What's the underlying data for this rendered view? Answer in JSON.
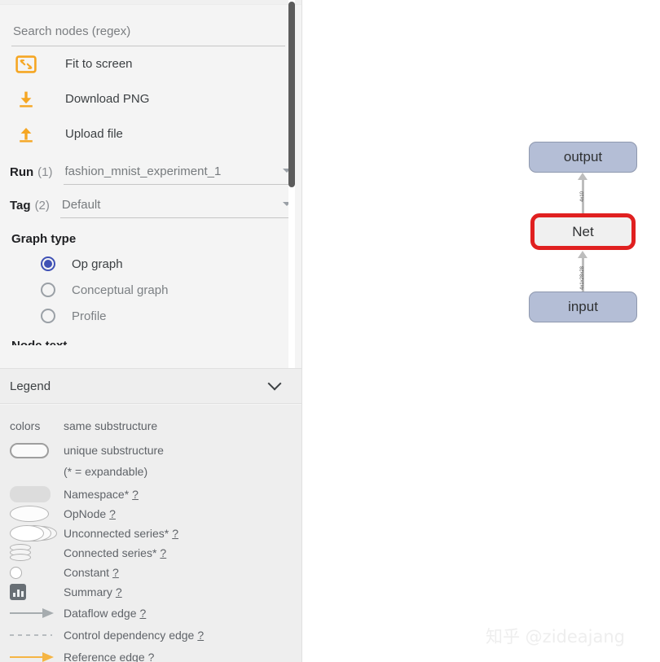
{
  "sidebar": {
    "search": {
      "placeholder": "Search nodes (regex)",
      "value": ""
    },
    "actions": [
      {
        "label": "Fit to screen",
        "icon": "fit-to-screen-icon"
      },
      {
        "label": "Download PNG",
        "icon": "download-icon"
      },
      {
        "label": "Upload file",
        "icon": "upload-icon"
      }
    ],
    "selectors": [
      {
        "key": "Run",
        "count": "(1)",
        "value": "fashion_mnist_experiment_1"
      },
      {
        "key": "Tag",
        "count": "(2)",
        "value": "Default"
      }
    ],
    "graph_type": {
      "title": "Graph type",
      "options": [
        {
          "label": "Op graph",
          "selected": true,
          "enabled": true
        },
        {
          "label": "Conceptual graph",
          "selected": false,
          "enabled": false
        },
        {
          "label": "Profile",
          "selected": false,
          "enabled": false
        }
      ]
    },
    "cut_off_heading": "Node text"
  },
  "legend": {
    "header": "Legend",
    "rows": [
      {
        "symbol": "colors-label",
        "text": "same substructure",
        "help": ""
      },
      {
        "symbol": "unique-substructure-shape",
        "text": "unique substructure",
        "help": ""
      },
      {
        "symbol": "none",
        "text": "(* = expandable)",
        "help": ""
      },
      {
        "symbol": "namespace-shape",
        "text": "Namespace*",
        "help": "?"
      },
      {
        "symbol": "opnode-shape",
        "text": "OpNode",
        "help": "?"
      },
      {
        "symbol": "unconnected-series-shape",
        "text": "Unconnected series*",
        "help": "?"
      },
      {
        "symbol": "connected-series-shape",
        "text": "Connected series*",
        "help": "?"
      },
      {
        "symbol": "constant-shape",
        "text": "Constant",
        "help": "?"
      },
      {
        "symbol": "summary-shape",
        "text": "Summary",
        "help": "?"
      },
      {
        "symbol": "dataflow-edge-shape",
        "text": "Dataflow edge",
        "help": "?"
      },
      {
        "symbol": "control-dependency-edge-shape",
        "text": "Control dependency edge",
        "help": "?"
      },
      {
        "symbol": "reference-edge-shape",
        "text": "Reference edge",
        "help": "?"
      }
    ],
    "colors_label": "colors"
  },
  "graph": {
    "nodes": [
      {
        "id": "output",
        "label": "output",
        "type": "io",
        "selected": false
      },
      {
        "id": "net",
        "label": "Net",
        "type": "namespace",
        "selected": true
      },
      {
        "id": "input",
        "label": "input",
        "type": "io",
        "selected": false
      }
    ],
    "edges": [
      {
        "from": "net",
        "to": "output",
        "label": "4x10"
      },
      {
        "from": "input",
        "to": "net",
        "label": "4x1x28x28"
      }
    ]
  },
  "watermark": {
    "text": "知乎 @zideajang"
  },
  "colors": {
    "accent_orange": "#f5a623",
    "radio_selected": "#3f51b5",
    "selection_red": "#e02020",
    "io_node_fill": "#b4bed6",
    "namespace_fill": "#f0f0f0",
    "edge_grey": "#bdbdbd",
    "reference_edge": "#f5b544"
  }
}
